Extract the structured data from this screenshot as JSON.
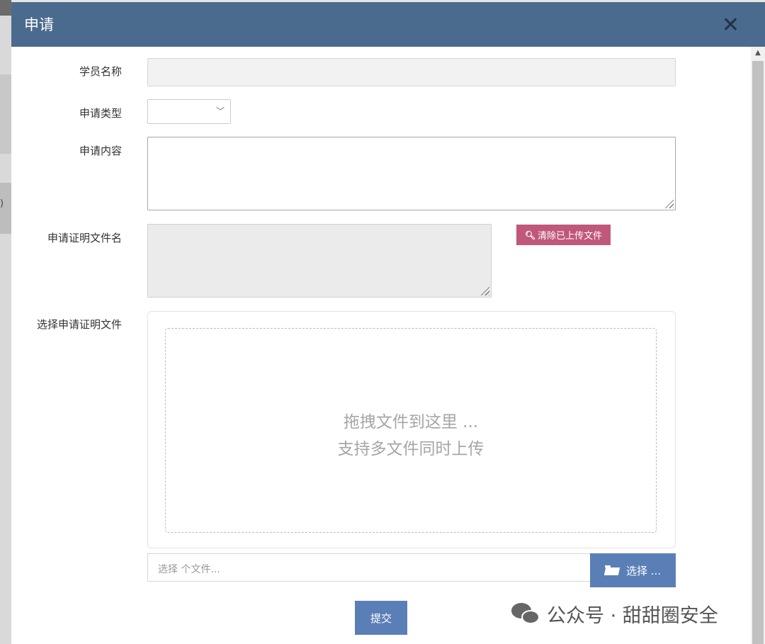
{
  "dialog": {
    "title": "申请",
    "close_glyph": "✕"
  },
  "form": {
    "student_name_label": "学员名称",
    "apply_type_label": "申请类型",
    "apply_content_label": "申请内容",
    "proof_filename_label": "申请证明文件名",
    "select_proof_label": "选择申请证明文件",
    "clear_button_label": "清除已上传文件",
    "dropzone_line1": "拖拽文件到这里 ...",
    "dropzone_line2": "支持多文件同时上传",
    "file_caption_placeholder": "选择 个文件...",
    "browse_button_label": "选择 ...",
    "submit_button_label": "提交"
  },
  "background": {
    "peek_text": ")"
  },
  "watermark": {
    "text": "公众号 · 甜甜圈安全"
  },
  "colors": {
    "header": "#4b6b8e",
    "clear_button": "#c0587b",
    "primary_button": "#5a7fb6"
  }
}
